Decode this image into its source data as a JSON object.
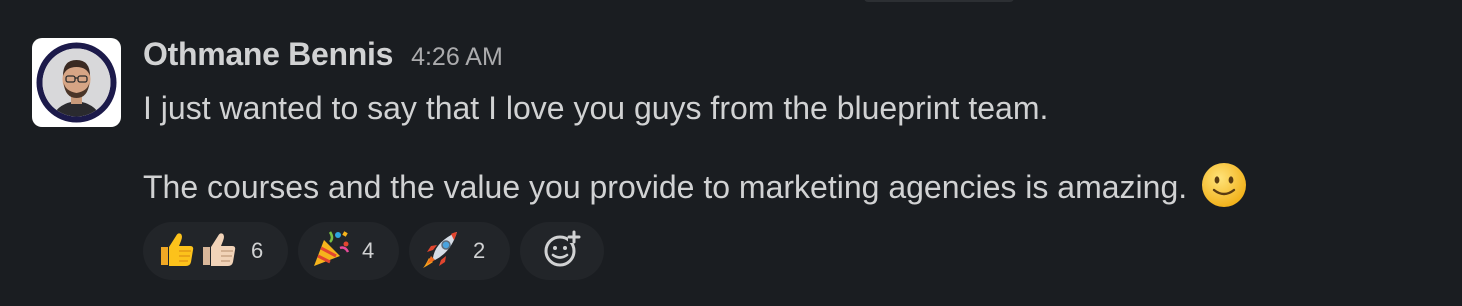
{
  "message": {
    "author": "Othmane Bennis",
    "timestamp": "4:26 AM",
    "lines": [
      "I just wanted to say that I love you guys from the blueprint team.",
      "The courses and the value you provide to marketing agencies is amazing."
    ],
    "inline_emoji": "slightly-smiling-face-icon"
  },
  "reactions": [
    {
      "emoji": "thumbs-up-icon",
      "count": "6"
    },
    {
      "emoji": "party-popper-icon",
      "count": "4"
    },
    {
      "emoji": "rocket-icon",
      "count": "2"
    }
  ],
  "add_reaction": {
    "icon": "add-emoji-icon"
  },
  "colors": {
    "background": "#1a1d21",
    "text": "#d1d2d3",
    "muted": "#ababad",
    "pill": "#222529"
  }
}
